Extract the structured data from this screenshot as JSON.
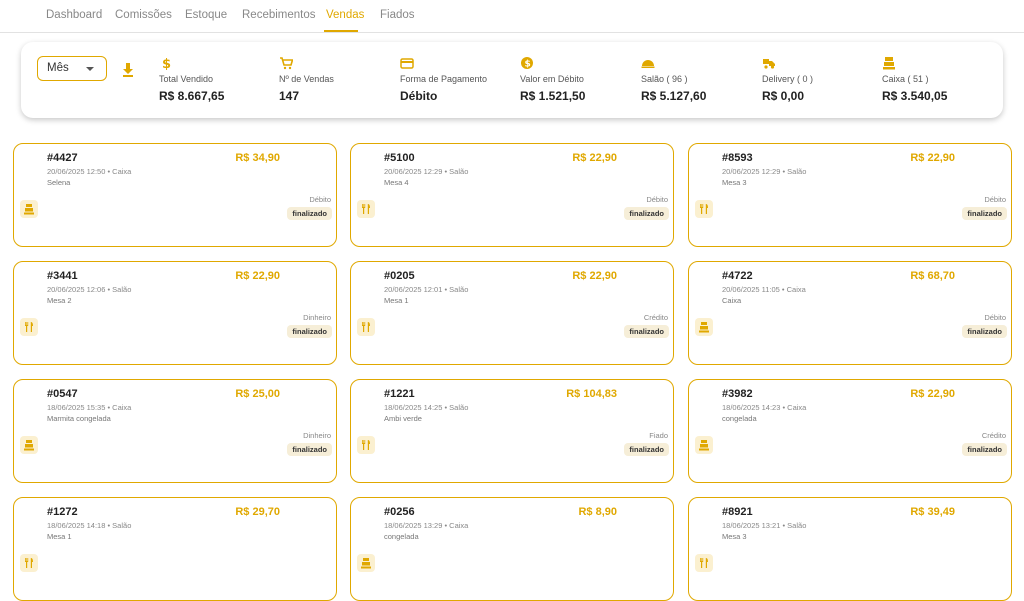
{
  "nav": {
    "tabs": [
      {
        "label": "Dashboard"
      },
      {
        "label": "Comissões"
      },
      {
        "label": "Estoque"
      },
      {
        "label": "Recebimentos"
      },
      {
        "label": "Vendas",
        "active": true
      },
      {
        "label": "Fiados"
      }
    ]
  },
  "summary": {
    "period": "Mês",
    "metrics": [
      {
        "icon": "dollar-icon",
        "label": "Total Vendido",
        "value": "R$ 8.667,65"
      },
      {
        "icon": "cart-icon",
        "label": "Nº de Vendas",
        "value": "147"
      },
      {
        "icon": "credit-card-icon",
        "label": "Forma de Pagamento",
        "value": "Débito"
      },
      {
        "icon": "coin-icon",
        "label": "Valor em Débito",
        "value": "R$ 1.521,50"
      },
      {
        "icon": "cloche-icon",
        "label": "Salão ( 96 )",
        "value": "R$ 5.127,60"
      },
      {
        "icon": "delivery-icon",
        "label": "Delivery ( 0 )",
        "value": "R$ 0,00"
      },
      {
        "icon": "cash-register-icon",
        "label": "Caixa ( 51 )",
        "value": "R$ 3.540,05"
      }
    ]
  },
  "sales": [
    {
      "id": "#4427",
      "datetime": "20/06/2025 12:50 • Caixa",
      "desc": "Selena",
      "amount": "R$ 34,90",
      "payment": "Débito",
      "status": "finalizado",
      "icon": "cash-register-icon"
    },
    {
      "id": "#5100",
      "datetime": "20/06/2025 12:29 • Salão",
      "desc": "Mesa 4",
      "amount": "R$ 22,90",
      "payment": "Débito",
      "status": "finalizado",
      "icon": "fork-knife-icon"
    },
    {
      "id": "#8593",
      "datetime": "20/06/2025 12:29 • Salão",
      "desc": "Mesa 3",
      "amount": "R$ 22,90",
      "payment": "Débito",
      "status": "finalizado",
      "icon": "fork-knife-icon"
    },
    {
      "id": "#3441",
      "datetime": "20/06/2025 12:06 • Salão",
      "desc": "Mesa 2",
      "amount": "R$ 22,90",
      "payment": "Dinheiro",
      "status": "finalizado",
      "icon": "fork-knife-icon"
    },
    {
      "id": "#0205",
      "datetime": "20/06/2025 12:01 • Salão",
      "desc": "Mesa 1",
      "amount": "R$ 22,90",
      "payment": "Crédito",
      "status": "finalizado",
      "icon": "fork-knife-icon"
    },
    {
      "id": "#4722",
      "datetime": "20/06/2025 11:05 • Caixa",
      "desc": "Caixa",
      "amount": "R$ 68,70",
      "payment": "Débito",
      "status": "finalizado",
      "icon": "cash-register-icon"
    },
    {
      "id": "#0547",
      "datetime": "18/06/2025 15:35 • Caixa",
      "desc": "Marmita congelada",
      "amount": "R$ 25,00",
      "payment": "Dinheiro",
      "status": "finalizado",
      "icon": "cash-register-icon"
    },
    {
      "id": "#1221",
      "datetime": "18/06/2025 14:25 • Salão",
      "desc": "Ambi verde",
      "amount": "R$ 104,83",
      "payment": "Fiado",
      "status": "finalizado",
      "icon": "fork-knife-icon"
    },
    {
      "id": "#3982",
      "datetime": "18/06/2025 14:23 • Caixa",
      "desc": "congelada",
      "amount": "R$ 22,90",
      "payment": "Crédito",
      "status": "finalizado",
      "icon": "cash-register-icon"
    },
    {
      "id": "#1272",
      "datetime": "18/06/2025 14:18 • Salão",
      "desc": "Mesa 1",
      "amount": "R$ 29,70",
      "payment": "",
      "status": "",
      "icon": "fork-knife-icon"
    },
    {
      "id": "#0256",
      "datetime": "18/06/2025 13:29 • Caixa",
      "desc": "congelada",
      "amount": "R$ 8,90",
      "payment": "",
      "status": "",
      "icon": "cash-register-icon"
    },
    {
      "id": "#8921",
      "datetime": "18/06/2025 13:21 • Salão",
      "desc": "Mesa 3",
      "amount": "R$ 39,49",
      "payment": "",
      "status": "",
      "icon": "fork-knife-icon"
    }
  ]
}
